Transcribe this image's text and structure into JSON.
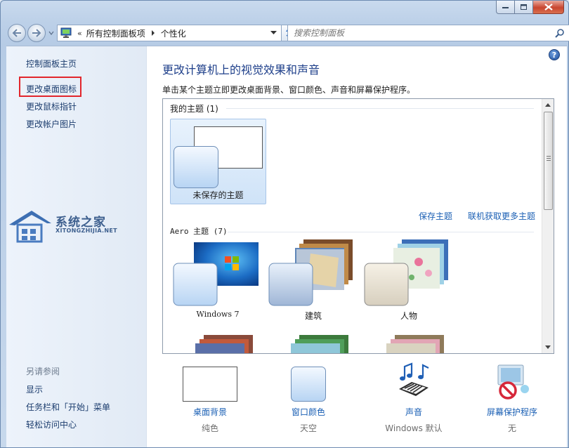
{
  "nav": {
    "breadcrumb": [
      "所有控制面板项",
      "个性化"
    ],
    "search_placeholder": "搜索控制面板",
    "chevron": "«"
  },
  "sidebar": {
    "home": "控制面板主页",
    "links": [
      "更改桌面图标",
      "更改鼠标指针",
      "更改帐户图片"
    ],
    "see_also_title": "另请参阅",
    "see_also": [
      "显示",
      "任务栏和「开始」菜单",
      "轻松访问中心"
    ]
  },
  "watermark": {
    "title": "系统之家",
    "subtitle": "XITONGZHIJIA.NET"
  },
  "main": {
    "title": "更改计算机上的视觉效果和声音",
    "description": "单击某个主题立即更改桌面背景、窗口颜色、声音和屏幕保护程序。",
    "help": "?"
  },
  "themes": {
    "my_group": "我的主题 (1)",
    "unsaved_label": "未保存的主题",
    "save_link": "保存主题",
    "online_link": "联机获取更多主题",
    "aero_group": "Aero 主题 (7)",
    "aero_items": [
      "Windows 7",
      "建筑",
      "人物"
    ]
  },
  "bottom": {
    "items": [
      {
        "label": "桌面背景",
        "value": "纯色"
      },
      {
        "label": "窗口颜色",
        "value": "天空"
      },
      {
        "label": "声音",
        "value": "Windows 默认"
      },
      {
        "label": "屏幕保护程序",
        "value": "无"
      }
    ]
  },
  "colors": {
    "accent_link": "#1a5fb4",
    "title": "#1e3f8a",
    "highlight": "#e2262c"
  }
}
